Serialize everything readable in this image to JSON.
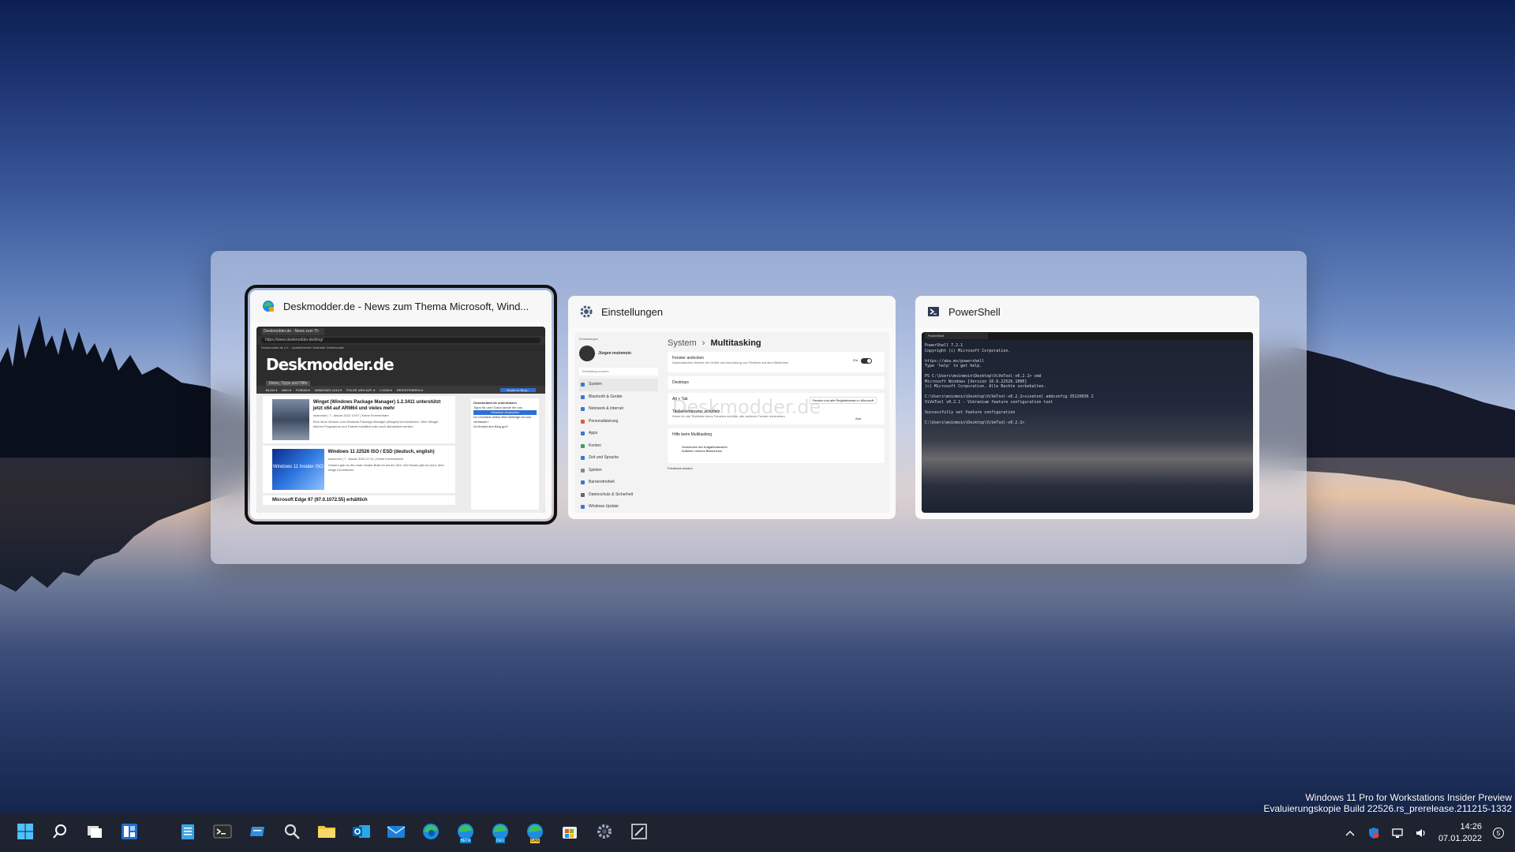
{
  "switcher": {
    "cards": [
      {
        "title": "Deskmodder.de - News zum Thema Microsoft, Wind...",
        "icon": "edge-canary-icon",
        "selected": true,
        "browser": {
          "tab_label": "Deskmodder.de - News zum Th",
          "url": "https://www.deskmodder.de/blog/",
          "favorites": "Deskmodder.de | D...  Updatebereich  Kalender  Deskmodder",
          "logo": "Deskmodder.de",
          "logo_sub": "News, Tipps und Hilfe",
          "nav": [
            "BLOG ▾",
            "WIKI ▾",
            "FORUM ▾",
            "WINDOWS 11/10 ▾",
            "FOLGE UNS AUF: ▾",
            "LOGIN ▾",
            "REGISTRIEREN ▾"
          ],
          "search_placeholder": "Suche im Blog...",
          "posts": [
            {
              "title": "Winget (Windows Package Manager) 1.2.3411 unterstützt jetzt x64 auf ARM64 und vieles mehr",
              "meta": "moinmoin | 7. Januar 2022 14:07 | Keine Kommentare",
              "excerpt": "Eine neue Version vom Windows Package Manager (Winget) ist erschienen. Über Winget können Programme und Pakete installiert oder auch aktualisiert werden."
            },
            {
              "title": "Windows 11 22526 ISO / ESD (deutsch, english)",
              "meta": "moinmoin | 7. Januar 2022 07:11 | Keine Kommentare",
              "excerpt": "Gestern gab es die erste Insider Build im neuen Jahr. Viel Neues gibt es nicht, aber einige Korrekturen.",
              "image_label": "Windows 11 Insider ISO"
            },
            {
              "title": "Microsoft Edge 97 (97.0.1072.55) erhältlich",
              "meta": "",
              "excerpt": ""
            }
          ],
          "side": [
            "Deskmodder.de unterstützen",
            "Tipps für uns? Dann sende ihn uns",
            "Hinweise einsenden",
            "Du möchtest selbst öfter Beiträge bei uns verfassen?",
            "Du findest den Blog gut?"
          ]
        }
      },
      {
        "title": "Einstellungen",
        "icon": "gear-icon",
        "selected": false,
        "settings": {
          "window_label": "Einstellungen",
          "user": "Jürgen moinmoin",
          "search_placeholder": "Einstellung suchen",
          "nav": [
            "System",
            "Bluetooth & Geräte",
            "Netzwerk & Internet",
            "Personalisierung",
            "Apps",
            "Konten",
            "Zeit und Sprache",
            "Spielen",
            "Barrierefreiheit",
            "Datenschutz & Sicherheit",
            "Windows Update"
          ],
          "breadcrumb_parent": "System",
          "breadcrumb_sep": "›",
          "breadcrumb_current": "Multitasking",
          "rows": [
            {
              "label": "Fenster andocken",
              "desc": "Automatisches Ändern der Größe und Anordnung von Fenstern auf dem Bildschirm",
              "value": "Ein"
            },
            {
              "label": "Desktops",
              "desc": "",
              "value": ""
            },
            {
              "label": "Alt + Tab",
              "desc": "",
              "value": "Fenster und alle Registerkarten in Microsoft"
            },
            {
              "label": "Titelleistenfenster schütteln",
              "desc": "Wenn ich die Titelleiste eines Fensters schüttle, alle anderen Fenster minimieren",
              "value": "Aus"
            },
            {
              "label": "Hilfe beim Multitasking",
              "desc": "",
              "value": ""
            }
          ],
          "links": [
            "Verwenden der Aufgabenansicht",
            "Aufteilen meines Bildschirms"
          ],
          "feedback": "Feedback senden",
          "watermark": "Deskmodder.de"
        }
      },
      {
        "title": "PowerShell",
        "icon": "powershell-icon",
        "selected": false,
        "terminal": {
          "tab_label": "PowerShell",
          "lines": [
            "PowerShell 7.2.1",
            "Copyright (c) Microsoft Corporation.",
            "",
            "https://aka.ms/powershell",
            "Type 'help' to get help.",
            "",
            "PS C:\\Users\\moinmoin\\Desktop\\ViVeTool-v0.2.1> cmd",
            "Microsoft Windows [Version 10.0.22526.1000]",
            "(c) Microsoft Corporation. Alle Rechte vorbehalten.",
            "",
            "C:\\Users\\moinmoin\\Desktop\\ViVeTool-v0.2.1>vivetool addconfig 35220036 2",
            "ViVeTool v0.2.1 - Vibranium feature configuration tool",
            "",
            "Successfully set feature configuration",
            "",
            "C:\\Users\\moinmoin\\Desktop\\ViVeTool-v0.2.1>"
          ]
        }
      }
    ]
  },
  "watermark": {
    "line1": "Windows 11 Pro for Workstations Insider Preview",
    "line2": "Evaluierungskopie Build 22526.rs_prerelease.211215-1332"
  },
  "taskbar": {
    "items": [
      {
        "name": "start-button",
        "icon": "windows-logo-icon"
      },
      {
        "name": "search-button",
        "icon": "search-icon"
      },
      {
        "name": "task-view-button",
        "icon": "task-view-icon"
      },
      {
        "name": "widgets-button",
        "icon": "widgets-icon"
      },
      {
        "name": "notepad-button",
        "icon": "notepad-icon"
      },
      {
        "name": "terminal-button",
        "icon": "terminal-icon"
      },
      {
        "name": "app-button",
        "icon": "app-icon"
      },
      {
        "name": "magnifier-button",
        "icon": "magnifier-icon"
      },
      {
        "name": "explorer-button",
        "icon": "folder-icon"
      },
      {
        "name": "outlook-button",
        "icon": "outlook-icon"
      },
      {
        "name": "mail-button",
        "icon": "mail-icon"
      },
      {
        "name": "edge-button",
        "icon": "edge-icon"
      },
      {
        "name": "edge-beta-button",
        "icon": "edge-beta-icon",
        "label": "BETA"
      },
      {
        "name": "edge-dev-button",
        "icon": "edge-dev-icon",
        "label": "DEV"
      },
      {
        "name": "edge-canary-button",
        "icon": "edge-canary-icon",
        "label": "CAN"
      },
      {
        "name": "store-button",
        "icon": "store-icon"
      },
      {
        "name": "settings-button",
        "icon": "gear-icon"
      },
      {
        "name": "snipping-button",
        "icon": "pen-icon"
      }
    ],
    "tray": {
      "time": "14:26",
      "date": "07.01.2022",
      "notification_count": "5"
    }
  },
  "colors": {
    "accent": "#0078d4",
    "edge_blue": "#1b8de4",
    "edge_green": "#3fbf5f",
    "folder_yellow": "#f2c337",
    "taskbar_bg": "#20242e"
  }
}
